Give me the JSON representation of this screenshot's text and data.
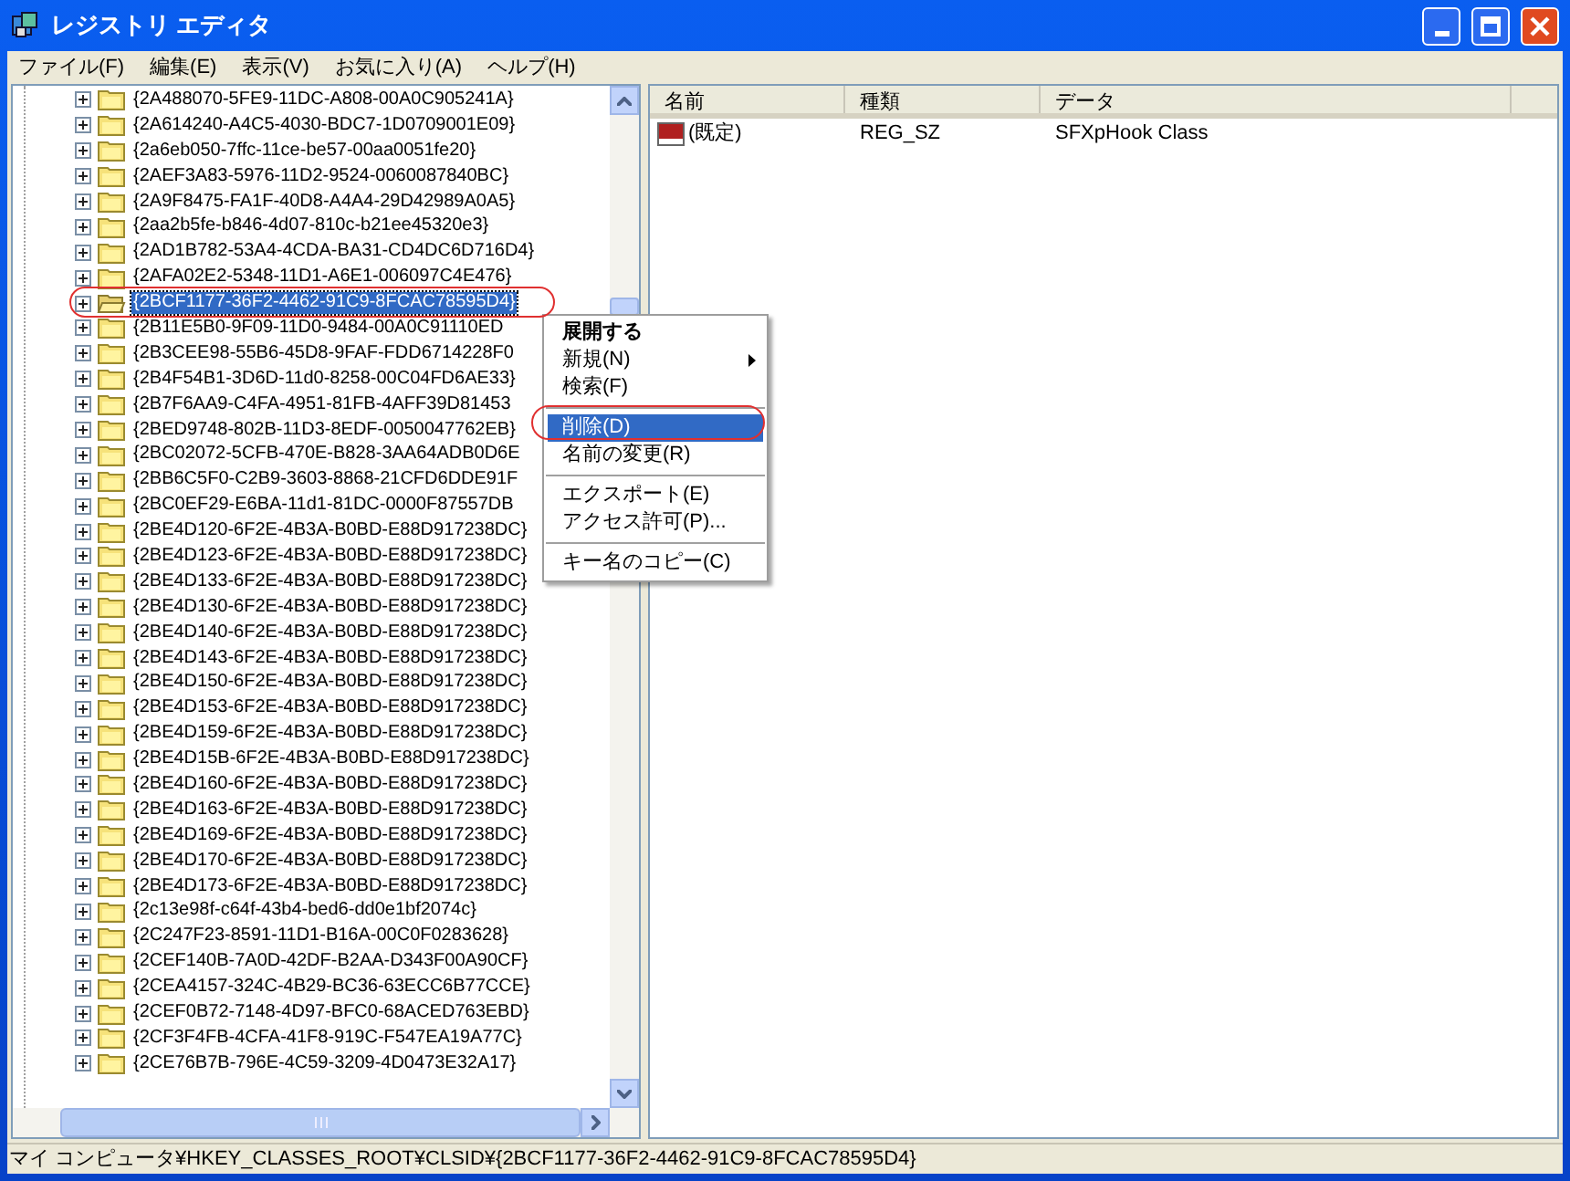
{
  "window": {
    "title": "レジストリ エディタ"
  },
  "menu": [
    "ファイル(F)",
    "編集(E)",
    "表示(V)",
    "お気に入り(A)",
    "ヘルプ(H)"
  ],
  "tree": {
    "items": [
      {
        "label": "{2A488070-5FE9-11DC-A808-00A0C905241A}",
        "selected": false,
        "expanded": false
      },
      {
        "label": "{2A614240-A4C5-4030-BDC7-1D0709001E09}",
        "selected": false,
        "expanded": false
      },
      {
        "label": "{2a6eb050-7ffc-11ce-be57-00aa0051fe20}",
        "selected": false,
        "expanded": false
      },
      {
        "label": "{2AEF3A83-5976-11D2-9524-0060087840BC}",
        "selected": false,
        "expanded": false
      },
      {
        "label": "{2A9F8475-FA1F-40D8-A4A4-29D42989A0A5}",
        "selected": false,
        "expanded": false
      },
      {
        "label": "{2aa2b5fe-b846-4d07-810c-b21ee45320e3}",
        "selected": false,
        "expanded": false
      },
      {
        "label": "{2AD1B782-53A4-4CDA-BA31-CD4DC6D716D4}",
        "selected": false,
        "expanded": false
      },
      {
        "label": "{2AFA02E2-5348-11D1-A6E1-006097C4E476}",
        "selected": false,
        "expanded": false
      },
      {
        "label": "{2BCF1177-36F2-4462-91C9-8FCAC78595D4}",
        "selected": true,
        "expanded": false
      },
      {
        "label": "{2B11E5B0-9F09-11D0-9484-00A0C91110ED",
        "selected": false,
        "expanded": false
      },
      {
        "label": "{2B3CEE98-55B6-45D8-9FAF-FDD6714228F0",
        "selected": false,
        "expanded": false
      },
      {
        "label": "{2B4F54B1-3D6D-11d0-8258-00C04FD6AE33}",
        "selected": false,
        "expanded": false
      },
      {
        "label": "{2B7F6AA9-C4FA-4951-81FB-4AFF39D81453",
        "selected": false,
        "expanded": false
      },
      {
        "label": "{2BED9748-802B-11D3-8EDF-0050047762EB}",
        "selected": false,
        "expanded": false
      },
      {
        "label": "{2BC02072-5CFB-470E-B828-3AA64ADB0D6E",
        "selected": false,
        "expanded": false
      },
      {
        "label": "{2BB6C5F0-C2B9-3603-8868-21CFD6DDE91F",
        "selected": false,
        "expanded": false
      },
      {
        "label": "{2BC0EF29-E6BA-11d1-81DC-0000F87557DB",
        "selected": false,
        "expanded": false
      },
      {
        "label": "{2BE4D120-6F2E-4B3A-B0BD-E88D917238DC}",
        "selected": false,
        "expanded": false
      },
      {
        "label": "{2BE4D123-6F2E-4B3A-B0BD-E88D917238DC}",
        "selected": false,
        "expanded": false
      },
      {
        "label": "{2BE4D133-6F2E-4B3A-B0BD-E88D917238DC}",
        "selected": false,
        "expanded": false
      },
      {
        "label": "{2BE4D130-6F2E-4B3A-B0BD-E88D917238DC}",
        "selected": false,
        "expanded": false
      },
      {
        "label": "{2BE4D140-6F2E-4B3A-B0BD-E88D917238DC}",
        "selected": false,
        "expanded": false
      },
      {
        "label": "{2BE4D143-6F2E-4B3A-B0BD-E88D917238DC}",
        "selected": false,
        "expanded": false
      },
      {
        "label": "{2BE4D150-6F2E-4B3A-B0BD-E88D917238DC}",
        "selected": false,
        "expanded": false
      },
      {
        "label": "{2BE4D153-6F2E-4B3A-B0BD-E88D917238DC}",
        "selected": false,
        "expanded": false
      },
      {
        "label": "{2BE4D159-6F2E-4B3A-B0BD-E88D917238DC}",
        "selected": false,
        "expanded": false
      },
      {
        "label": "{2BE4D15B-6F2E-4B3A-B0BD-E88D917238DC}",
        "selected": false,
        "expanded": false
      },
      {
        "label": "{2BE4D160-6F2E-4B3A-B0BD-E88D917238DC}",
        "selected": false,
        "expanded": false
      },
      {
        "label": "{2BE4D163-6F2E-4B3A-B0BD-E88D917238DC}",
        "selected": false,
        "expanded": false
      },
      {
        "label": "{2BE4D169-6F2E-4B3A-B0BD-E88D917238DC}",
        "selected": false,
        "expanded": false
      },
      {
        "label": "{2BE4D170-6F2E-4B3A-B0BD-E88D917238DC}",
        "selected": false,
        "expanded": false
      },
      {
        "label": "{2BE4D173-6F2E-4B3A-B0BD-E88D917238DC}",
        "selected": false,
        "expanded": false
      },
      {
        "label": "{2c13e98f-c64f-43b4-bed6-dd0e1bf2074c}",
        "selected": false,
        "expanded": false
      },
      {
        "label": "{2C247F23-8591-11D1-B16A-00C0F0283628}",
        "selected": false,
        "expanded": false
      },
      {
        "label": "{2CEF140B-7A0D-42DF-B2AA-D343F00A90CF}",
        "selected": false,
        "expanded": false
      },
      {
        "label": "{2CEA4157-324C-4B29-BC36-63ECC6B77CCE}",
        "selected": false,
        "expanded": false
      },
      {
        "label": "{2CEF0B72-7148-4D97-BFC0-68ACED763EBD}",
        "selected": false,
        "expanded": false
      },
      {
        "label": "{2CF3F4FB-4CFA-41F8-919C-F547EA19A77C}",
        "selected": false,
        "expanded": false
      },
      {
        "label": "{2CE76B7B-796E-4C59-3209-4D0473E32A17}",
        "selected": false,
        "expanded": false
      }
    ]
  },
  "values": {
    "columns": [
      "名前",
      "種類",
      "データ"
    ],
    "rows": [
      {
        "name": "(既定)",
        "type": "REG_SZ",
        "data": "SFXpHook Class"
      }
    ]
  },
  "context_menu": {
    "items": [
      {
        "kind": "item",
        "label": "展開する",
        "default": true,
        "selected": false
      },
      {
        "kind": "submenu",
        "label": "新規(N)",
        "default": false,
        "selected": false
      },
      {
        "kind": "item",
        "label": "検索(F)",
        "default": false,
        "selected": false
      },
      {
        "kind": "separator"
      },
      {
        "kind": "item",
        "label": "削除(D)",
        "default": false,
        "selected": true
      },
      {
        "kind": "item",
        "label": "名前の変更(R)",
        "default": false,
        "selected": false
      },
      {
        "kind": "separator"
      },
      {
        "kind": "item",
        "label": "エクスポート(E)",
        "default": false,
        "selected": false
      },
      {
        "kind": "item",
        "label": "アクセス許可(P)...",
        "default": false,
        "selected": false
      },
      {
        "kind": "separator"
      },
      {
        "kind": "item",
        "label": "キー名のコピー(C)",
        "default": false,
        "selected": false
      }
    ]
  },
  "status_bar": "マイ コンピュータ¥HKEY_CLASSES_ROOT¥CLSID¥{2BCF1177-36F2-4462-91C9-8FCAC78595D4}"
}
